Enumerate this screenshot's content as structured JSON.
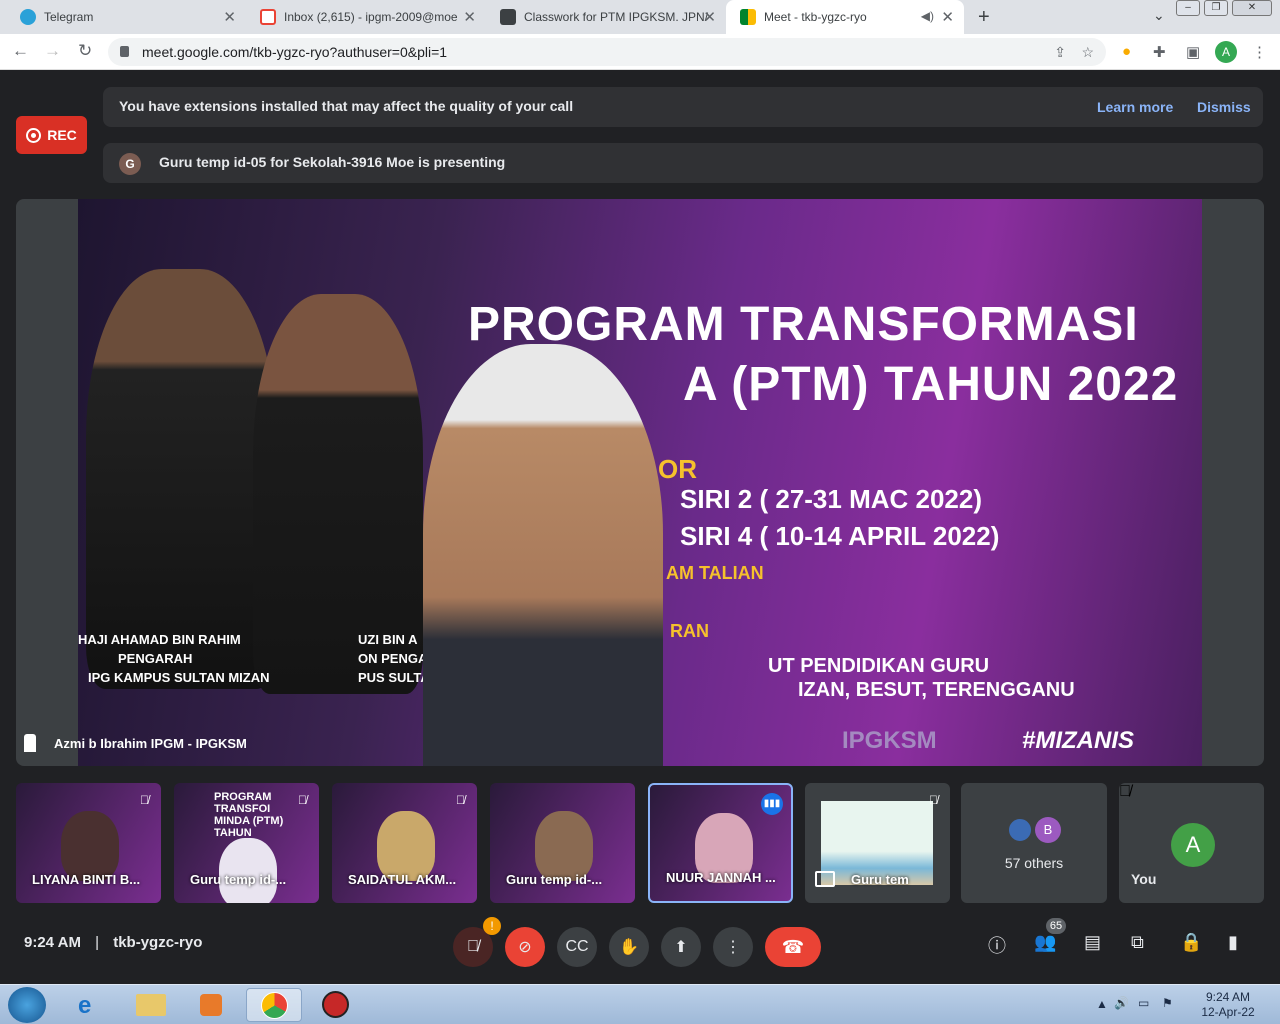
{
  "tabs": [
    {
      "title": "Telegram"
    },
    {
      "title": "Inbox (2,615) - ipgm-2009@moe"
    },
    {
      "title": "Classwork for PTM IPGKSM. JPN/"
    },
    {
      "title": "Meet - tkb-ygzc-ryo"
    }
  ],
  "tab_close": "✕",
  "address": {
    "url": "meet.google.com/tkb-ygzc-ryo?authuser=0&pli=1"
  },
  "profile_initial": "A",
  "ext_banner": {
    "text": "You have extensions installed that may affect the quality of your call",
    "learn_more": "Learn more",
    "dismiss": "Dismiss"
  },
  "rec": {
    "label": "REC"
  },
  "presenting": {
    "avatar": "G",
    "text": "Guru temp id-05 for Sekolah-3916 Moe is presenting"
  },
  "slide": {
    "title_line1": "PROGRAM TRANSFORMASI",
    "title_line2": "A (PTM) TAHUN 2022",
    "line3": "OR",
    "siri2": "SIRI 2 ( 27-31 MAC 2022)",
    "siri4": "SIRI 4 ( 10-14 APRIL 2022)",
    "talian": "AM TALIAN",
    "ran": "RAN",
    "institut": "UT PENDIDIKAN GURU",
    "location": "IZAN, BESUT, TERENGGANU",
    "hashtag": "#MIZANIS",
    "ipgksm": "IPGKSM",
    "speaker1_name": "HAJI AHAMAD BIN RAHIM",
    "speaker1_role": "PENGARAH",
    "speaker1_campus": "IPG KAMPUS SULTAN MIZAN",
    "speaker2_name": "UZI BIN A",
    "speaker2_role": "ON PENGAR",
    "speaker2_campus": "PUS SULTA"
  },
  "main_tile": {
    "name": "Azmi b Ibrahim IPGM - IPGKSM"
  },
  "thumbnails": [
    {
      "name": "LIYANA BINTI B..."
    },
    {
      "name": "Guru temp id-..."
    },
    {
      "name": "SAIDATUL AKM..."
    },
    {
      "name": "Guru temp id-..."
    },
    {
      "name": "NUUR JANNAH ..."
    },
    {
      "name": "Guru tem"
    }
  ],
  "thumb_slide_text": {
    "a": "PROGRAM TRANSFOI",
    "b": "MINDA (PTM) TAHUN"
  },
  "others": {
    "label": "57 others",
    "avatar_b": "B"
  },
  "you": {
    "label": "You",
    "initial": "A"
  },
  "meeting": {
    "time": "9:24 AM",
    "separator": "|",
    "code": "tkb-ygzc-ryo"
  },
  "participants_count": "65",
  "warning_badge": "!",
  "taskbar": {
    "time": "9:24 AM",
    "date": "12-Apr-22"
  },
  "colors": {
    "accent_blue": "#8ab4f8",
    "end_call_red": "#ea4335",
    "rec_red": "#d93025",
    "bg": "#202124"
  },
  "icons": [
    "telegram-icon",
    "gmail-icon",
    "classroom-icon",
    "meet-icon",
    "lock-icon",
    "mic-off-icon",
    "camera-off-icon",
    "captions-icon",
    "hand-icon",
    "present-icon",
    "more-icon",
    "end-call-icon",
    "info-icon",
    "people-icon",
    "chat-icon",
    "activities-icon",
    "host-controls-icon"
  ]
}
